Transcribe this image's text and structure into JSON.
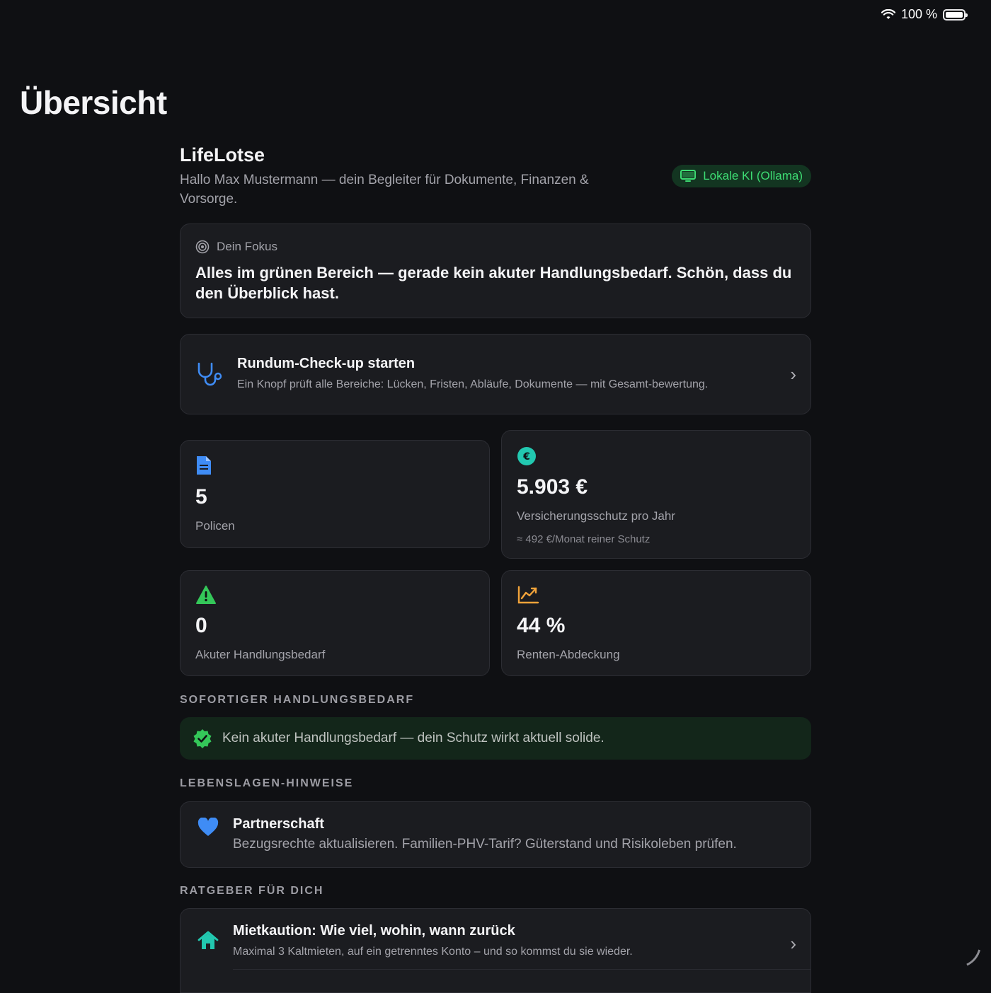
{
  "status": {
    "battery_text": "100 %",
    "battery_level": 1.0
  },
  "page_title": "Übersicht",
  "header": {
    "app_name": "LifeLotse",
    "greeting": "Hallo Max Mustermann — dein Begleiter für Dokumente, Finanzen & Vorsorge.",
    "ki_badge": "Lokale KI (Ollama)"
  },
  "focus": {
    "label": "Dein Fokus",
    "text": "Alles im grünen Bereich — gerade kein akuter Handlungsbedarf. Schön, dass du den Überblick hast."
  },
  "checkup": {
    "title": "Rundum-Check-up starten",
    "desc": "Ein Knopf prüft alle Bereiche: Lücken, Fristen, Abläufe, Dokumente — mit Gesamt-bewertung."
  },
  "stats": {
    "policies": {
      "value": "5",
      "label": "Policen"
    },
    "insurance": {
      "value": "5.903 €",
      "label": "Versicherungsschutz pro Jahr",
      "sub": "≈ 492 €/Monat reiner Schutz"
    },
    "urgent": {
      "value": "0",
      "label": "Akuter Handlungsbedarf"
    },
    "pension": {
      "value": "44 %",
      "label": "Renten-Abdeckung"
    }
  },
  "sections": {
    "urgent_title": "SOFORTIGER HANDLUNGSBEDARF",
    "urgent_ok": "Kein akuter Handlungsbedarf — dein Schutz wirkt aktuell solide.",
    "life_title": "LEBENSLAGEN-HINWEISE",
    "guide_title": "RATGEBER FÜR DICH"
  },
  "life_hint": {
    "title": "Partnerschaft",
    "desc": "Bezugsrechte aktualisieren. Familien-PHV-Tarif? Güterstand und Risikoleben prüfen."
  },
  "guide": {
    "title": "Mietkaution: Wie viel, wohin, wann zurück",
    "desc": "Maximal 3 Kaltmieten, auf ein getrenntes Konto – und so kommst du sie wieder."
  },
  "colors": {
    "accent_green": "#3ddc73",
    "accent_blue": "#3f8cf5",
    "accent_teal": "#22c8b0",
    "accent_orange": "#f2a33a",
    "card_bg": "#1b1c20"
  },
  "icons": [
    "wifi-icon",
    "battery-icon",
    "monitor-icon",
    "target-icon",
    "stethoscope-icon",
    "chevron-right-icon",
    "document-icon",
    "euro-icon",
    "warning-icon",
    "chart-icon",
    "check-seal-icon",
    "heart-icon",
    "house-icon"
  ]
}
